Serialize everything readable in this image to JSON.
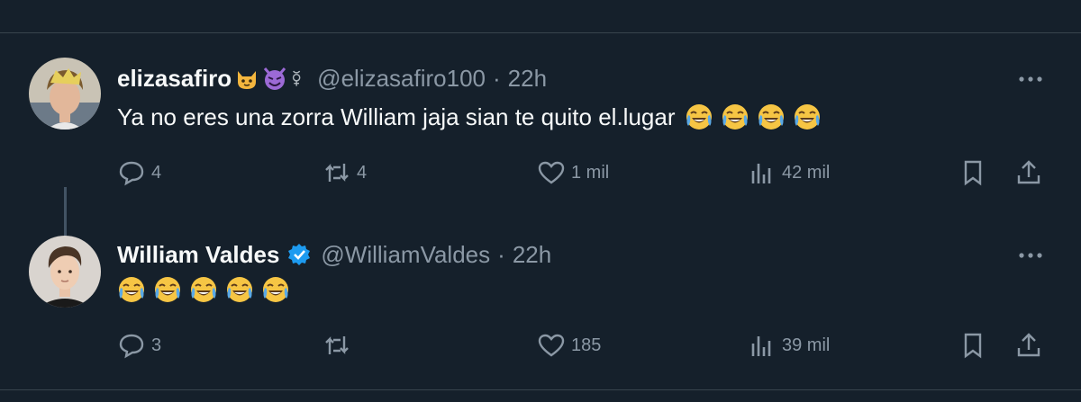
{
  "tweets": [
    {
      "name": "elizasafiro",
      "handle": "@elizasafiro100",
      "separator": "·",
      "time": "22h",
      "text": "Ya no eres una zorra William jaja sian te quito el.lugar",
      "replies": "4",
      "retweets": "4",
      "likes": "1 mil",
      "views": "42 mil"
    },
    {
      "name": "William Valdes",
      "handle": "@WilliamValdes",
      "separator": "·",
      "time": "22h",
      "text": "",
      "replies": "3",
      "retweets": "",
      "likes": "185",
      "views": "39 mil"
    }
  ],
  "colors": {
    "background": "#15202b",
    "muted": "#8b98a5",
    "verified": "#1d9bf0",
    "divider": "#38444d"
  },
  "icons": [
    "cat-emoji-icon",
    "devil-emoji-icon",
    "mercury-symbol-icon",
    "verified-badge-icon",
    "crying-laughing-emoji-icon",
    "more-icon",
    "reply-icon",
    "retweet-icon",
    "like-icon",
    "views-icon",
    "bookmark-icon",
    "share-icon"
  ]
}
